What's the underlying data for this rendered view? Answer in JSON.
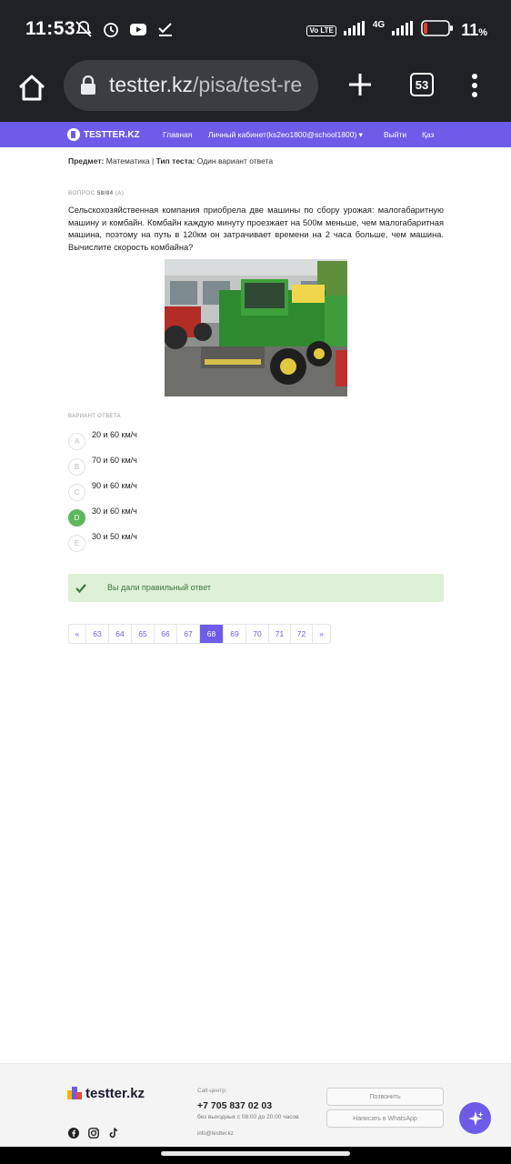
{
  "status_bar": {
    "time": "11:53",
    "network": "4G",
    "volte": "Vo LTE",
    "battery_pct": "11",
    "battery_unit": "%"
  },
  "browser": {
    "url_host": "testter.kz",
    "url_path": "/pisa/test-re",
    "tab_count": "53"
  },
  "site_nav": {
    "logo": "TESTTER.KZ",
    "items": [
      {
        "label": "Главная"
      },
      {
        "label": "Личный кабинет(ks2eo1800@school1800) ▾"
      },
      {
        "label": "Выйти"
      },
      {
        "label": "Қаз"
      }
    ]
  },
  "meta": {
    "subject_label": "Предмет:",
    "subject_value": "Математика |",
    "type_label": "Тип теста:",
    "type_value": "Один вариант ответа"
  },
  "question": {
    "label": "ВОПРОС",
    "number": "58/84",
    "flag": "(A)",
    "text": "Сельскохозяйственная компания приобрела две машины по сбору урожая: малогабаритную машину и комбайн. Комбайн каждую минуту проезжает на 500м меньше, чем малогабаритная машина, поэтому на путь в 120км он затрачивает времени на 2 часа больше, чем машина. Вычислите скорость комбайна?"
  },
  "answers": {
    "label": "ВАРИАНТ ОТВЕТА",
    "options": [
      {
        "letter": "A",
        "text": "20 и 60 км/ч",
        "correct": false
      },
      {
        "letter": "B",
        "text": "70 и 60 км/ч",
        "correct": false
      },
      {
        "letter": "C",
        "text": "90 и 60 км/ч",
        "correct": false
      },
      {
        "letter": "D",
        "text": "30 и 60 км/ч",
        "correct": true
      },
      {
        "letter": "E",
        "text": "30 и 50 км/ч",
        "correct": false
      }
    ]
  },
  "result": {
    "message": "Вы дали правильный ответ"
  },
  "pagination": {
    "prev": "«",
    "next": "»",
    "pages": [
      "63",
      "64",
      "65",
      "66",
      "67",
      "68",
      "69",
      "70",
      "71",
      "72"
    ],
    "active": "68"
  },
  "footer": {
    "logo": "testter.kz",
    "call_center_label": "Call-центр:",
    "phone": "+7 705 837 02 03",
    "hours": "без выходных с 08:00 до 20:00 часов",
    "email": "info@testter.kz",
    "call_button": "Позвонить",
    "whatsapp_button": "Написать в WhatsApp"
  },
  "colors": {
    "brand": "#6c5ce7",
    "success_bg": "#dff0d8",
    "success_text": "#3c763d",
    "correct_circle": "#5cb85c"
  }
}
